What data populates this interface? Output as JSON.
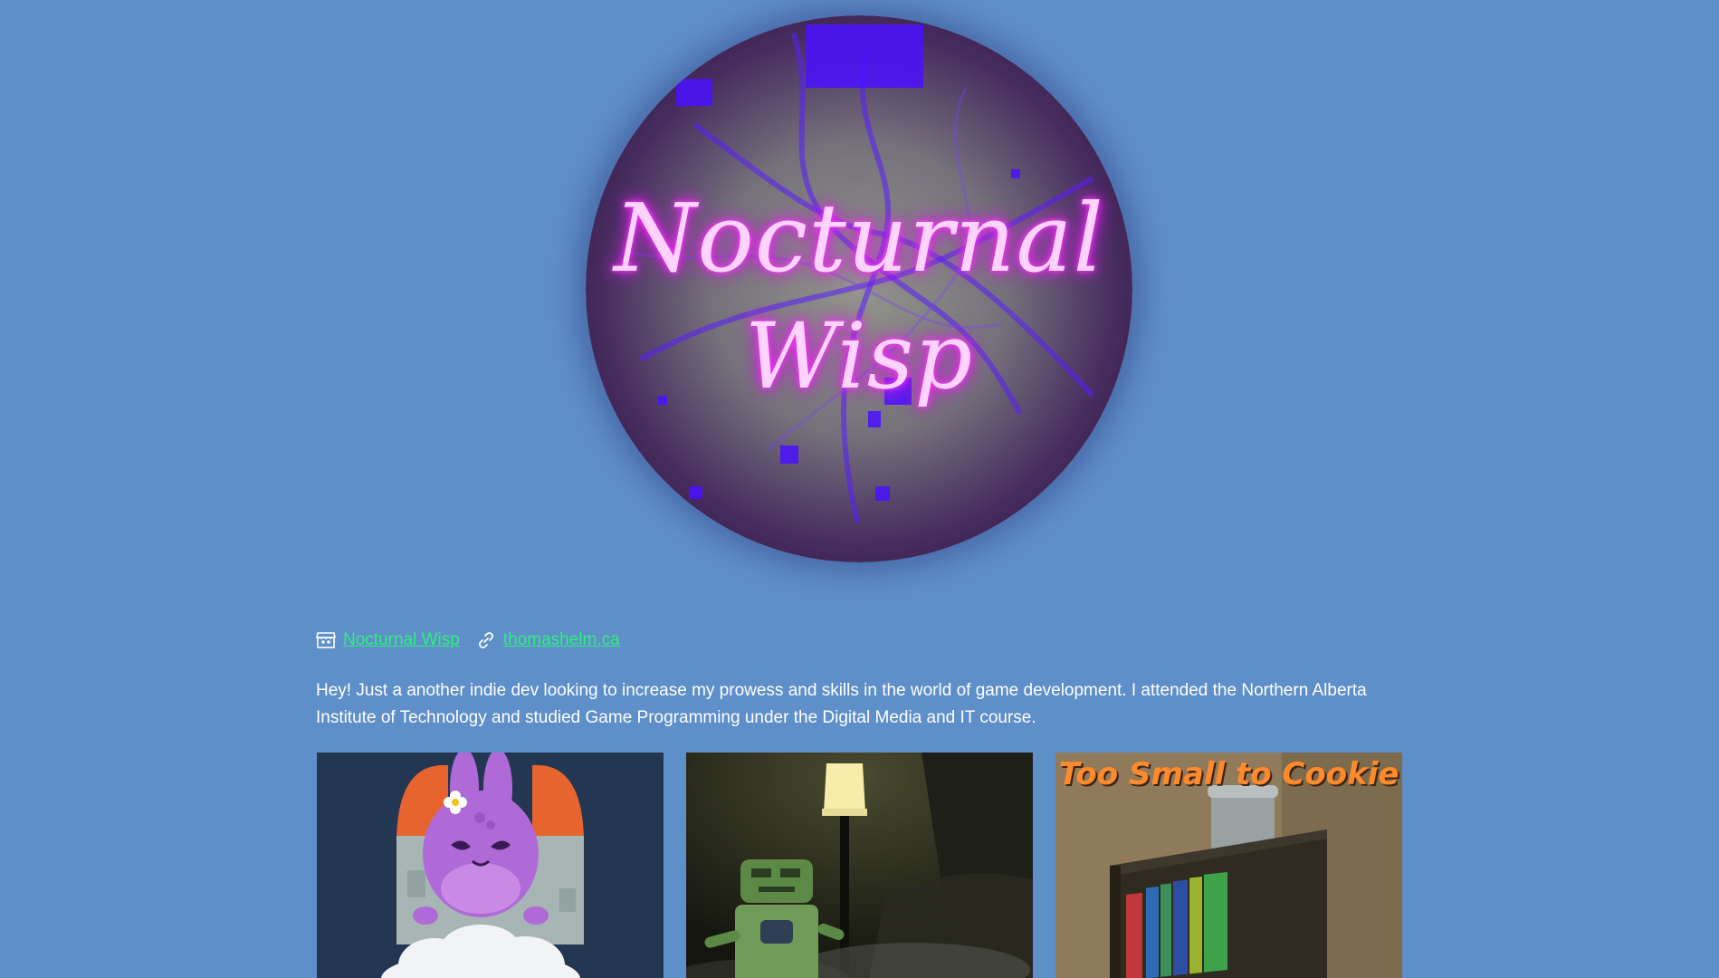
{
  "banner": {
    "logo_line1": "Nocturnal",
    "logo_line2": "Wisp"
  },
  "links": {
    "studio_icon": "itch-store-icon",
    "studio_label": "Nocturnal Wisp",
    "website_icon": "link-icon",
    "website_label": "thomashelm.ca"
  },
  "bio": {
    "text": "Hey! Just a another indie dev looking to increase my prowess and skills in the world of game development. I attended the Northern Alberta Institute of Technology and studied Game Programming under the Digital Media and IT course."
  },
  "games": [
    {
      "title_overlay": ""
    },
    {
      "title_overlay": ""
    },
    {
      "title_overlay": "Too Small to Cookie"
    }
  ],
  "colors": {
    "page_background": "#5f8fc9",
    "link": "#2ef07d",
    "logo_glow": "#ff3cff"
  }
}
